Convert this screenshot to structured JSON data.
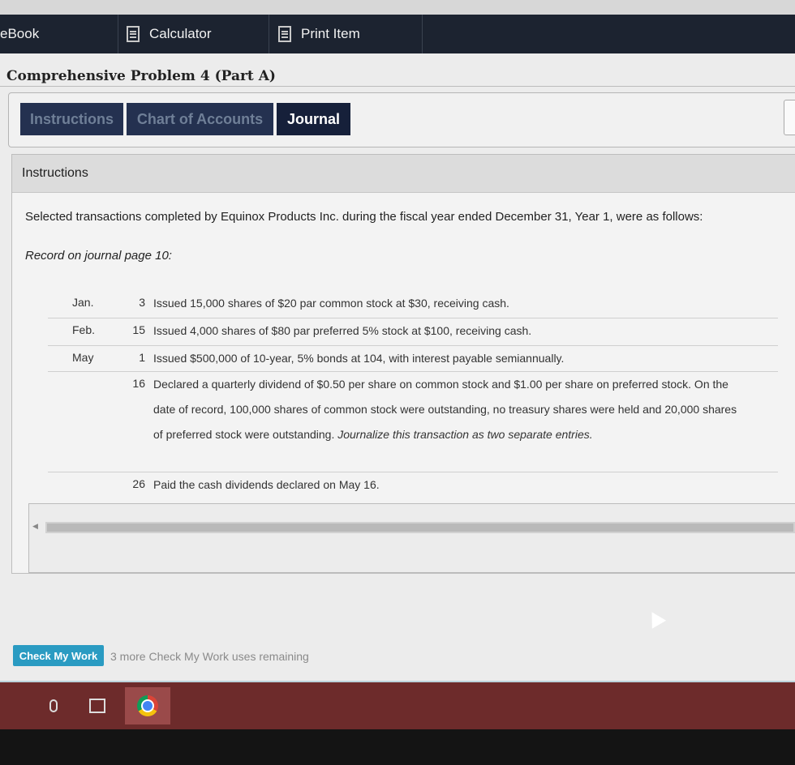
{
  "toolbar": {
    "ebook_label": "eBook",
    "calculator_label": "Calculator",
    "print_label": "Print Item"
  },
  "page": {
    "title": "Comprehensive Problem 4 (Part A)"
  },
  "tabs": [
    {
      "label": "Instructions",
      "active": false
    },
    {
      "label": "Chart of Accounts",
      "active": false
    },
    {
      "label": "Journal",
      "active": true
    }
  ],
  "instructions": {
    "header": "Instructions",
    "intro": "Selected transactions completed by Equinox Products Inc. during the fiscal year ended December 31, Year 1, were as follows:",
    "record_note": "Record on journal page 10:",
    "transactions": [
      {
        "month": "Jan.",
        "day": "3",
        "description": "Issued 15,000 shares of $20 par common stock at $30, receiving cash."
      },
      {
        "month": "Feb.",
        "day": "15",
        "description": "Issued 4,000 shares of $80 par preferred 5% stock at $100, receiving cash."
      },
      {
        "month": "May",
        "day": "1",
        "description": "Issued $500,000 of 10-year, 5% bonds at 104, with interest payable semiannually."
      },
      {
        "month": "",
        "day": "16",
        "description": "Declared a quarterly dividend of $0.50 per share on common stock and $1.00 per share on preferred stock. On the date of record, 100,000 shares of common stock were outstanding, no treasury shares were held and 20,000 shares of preferred stock were outstanding.",
        "emphasis": "Journalize this transaction as two separate entries."
      },
      {
        "month": "",
        "day": "26",
        "description": "Paid the cash dividends declared on May 16."
      }
    ]
  },
  "footer": {
    "check_label": "Check My Work",
    "remaining_note": "3 more Check My Work uses remaining"
  },
  "colors": {
    "toolbar_bg": "#1c2330",
    "tab_bg": "#243150",
    "tab_active_bg": "#16203a",
    "check_button": "#2a9bc2",
    "taskbar": "#6d2b2b"
  }
}
